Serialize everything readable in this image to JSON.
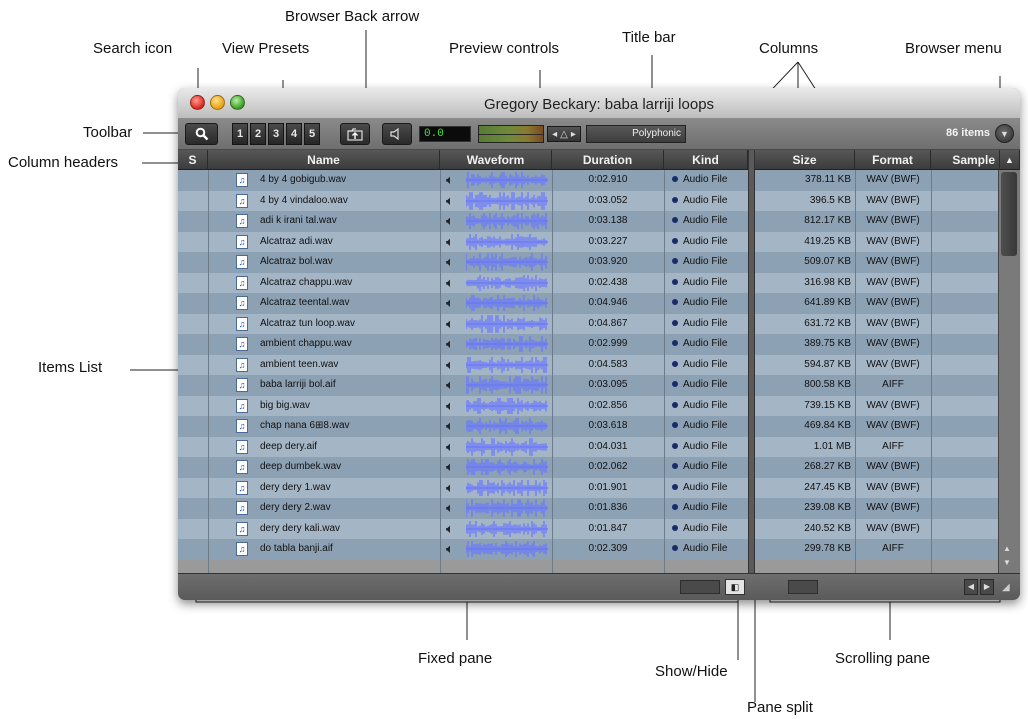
{
  "callouts": {
    "browser_back_arrow": "Browser Back arrow",
    "search_icon": "Search icon",
    "view_presets": "View Presets",
    "preview_controls": "Preview controls",
    "title_bar": "Title bar",
    "columns": "Columns",
    "browser_menu": "Browser menu",
    "toolbar": "Toolbar",
    "column_headers": "Column headers",
    "items_list": "Items List",
    "fixed_pane": "Fixed pane",
    "show_hide": "Show/Hide",
    "pane_split": "Pane split",
    "scrolling_pane": "Scrolling pane"
  },
  "window": {
    "title": "Gregory Beckary: baba larriji loops",
    "accent_row_odd": "#8da1b4",
    "accent_row_even": "#a4b5c5"
  },
  "toolbar": {
    "search_icon": "magnifier-icon",
    "presets": [
      "1",
      "2",
      "3",
      "4",
      "5"
    ],
    "back_icon": "folder-up-icon",
    "speaker_icon": "speaker-icon",
    "counter": "0.0",
    "polyphonic": "Polyphonic",
    "item_count": "86 items",
    "browser_menu_icon": "chevron-down-icon"
  },
  "columns": [
    "S",
    "Name",
    "Waveform",
    "Duration",
    "Kind",
    "Size",
    "Format",
    "Sample"
  ],
  "files": [
    {
      "name": "4 by 4 gobigub.wav",
      "duration": "0:02.910",
      "kind": "Audio File",
      "size": "378.11 KB",
      "format": "WAV (BWF)"
    },
    {
      "name": "4 by 4 vindaloo.wav",
      "duration": "0:03.052",
      "kind": "Audio File",
      "size": "396.5 KB",
      "format": "WAV (BWF)"
    },
    {
      "name": "adi k irani tal.wav",
      "duration": "0:03.138",
      "kind": "Audio File",
      "size": "812.17 KB",
      "format": "WAV (BWF)"
    },
    {
      "name": "Alcatraz adi.wav",
      "duration": "0:03.227",
      "kind": "Audio File",
      "size": "419.25 KB",
      "format": "WAV (BWF)"
    },
    {
      "name": "Alcatraz bol.wav",
      "duration": "0:03.920",
      "kind": "Audio File",
      "size": "509.07 KB",
      "format": "WAV (BWF)"
    },
    {
      "name": "Alcatraz chappu.wav",
      "duration": "0:02.438",
      "kind": "Audio File",
      "size": "316.98 KB",
      "format": "WAV (BWF)"
    },
    {
      "name": "Alcatraz teental.wav",
      "duration": "0:04.946",
      "kind": "Audio File",
      "size": "641.89 KB",
      "format": "WAV (BWF)"
    },
    {
      "name": "Alcatraz tun loop.wav",
      "duration": "0:04.867",
      "kind": "Audio File",
      "size": "631.72 KB",
      "format": "WAV (BWF)"
    },
    {
      "name": "ambient chappu.wav",
      "duration": "0:02.999",
      "kind": "Audio File",
      "size": "389.75 KB",
      "format": "WAV (BWF)"
    },
    {
      "name": "ambient teen.wav",
      "duration": "0:04.583",
      "kind": "Audio File",
      "size": "594.87 KB",
      "format": "WAV (BWF)"
    },
    {
      "name": "baba larriji bol.aif",
      "duration": "0:03.095",
      "kind": "Audio File",
      "size": "800.58 KB",
      "format": "AIFF"
    },
    {
      "name": "big big.wav",
      "duration": "0:02.856",
      "kind": "Audio File",
      "size": "739.15 KB",
      "format": "WAV (BWF)"
    },
    {
      "name": "chap nana 6⊞8.wav",
      "duration": "0:03.618",
      "kind": "Audio File",
      "size": "469.84 KB",
      "format": "WAV (BWF)"
    },
    {
      "name": "deep dery.aif",
      "duration": "0:04.031",
      "kind": "Audio File",
      "size": "1.01 MB",
      "format": "AIFF"
    },
    {
      "name": "deep dumbek.wav",
      "duration": "0:02.062",
      "kind": "Audio File",
      "size": "268.27 KB",
      "format": "WAV (BWF)"
    },
    {
      "name": "dery dery 1.wav",
      "duration": "0:01.901",
      "kind": "Audio File",
      "size": "247.45 KB",
      "format": "WAV (BWF)"
    },
    {
      "name": "dery dery 2.wav",
      "duration": "0:01.836",
      "kind": "Audio File",
      "size": "239.08 KB",
      "format": "WAV (BWF)"
    },
    {
      "name": "dery dery kali.wav",
      "duration": "0:01.847",
      "kind": "Audio File",
      "size": "240.52 KB",
      "format": "WAV (BWF)"
    },
    {
      "name": "do tabla banji.aif",
      "duration": "0:02.309",
      "kind": "Audio File",
      "size": "299.78 KB",
      "format": "AIFF"
    }
  ]
}
